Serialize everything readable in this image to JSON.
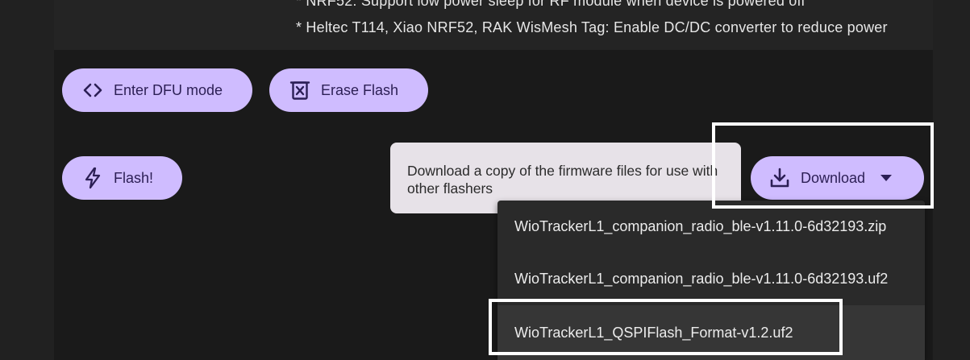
{
  "notes": {
    "line1": "* NRF52: Support low power sleep for RF module when device is powered off",
    "line2": "* Heltec T114, Xiao NRF52, RAK WisMesh Tag: Enable DC/DC converter to reduce power"
  },
  "actions": {
    "dfu_label": "Enter DFU mode",
    "erase_label": "Erase Flash",
    "flash_label": "Flash!",
    "download_label": "Download"
  },
  "tooltip": {
    "text": "Download a copy of the firmware files for use with other flashers"
  },
  "download_menu": {
    "items": [
      "WioTrackerL1_companion_radio_ble-v1.11.0-6d32193.zip",
      "WioTrackerL1_companion_radio_ble-v1.11.0-6d32193.uf2",
      "WioTrackerL1_QSPIFlash_Format-v1.2.uf2"
    ]
  },
  "colors": {
    "button_bg": "#cfbcff",
    "button_text": "#2c1f55",
    "page_bg": "#212121",
    "highlight": "#ffffff"
  },
  "icons": {
    "dfu": "code-brackets-icon",
    "erase": "erase-box-icon",
    "flash": "lightning-icon",
    "download": "download-icon",
    "caret": "caret-down-icon"
  }
}
